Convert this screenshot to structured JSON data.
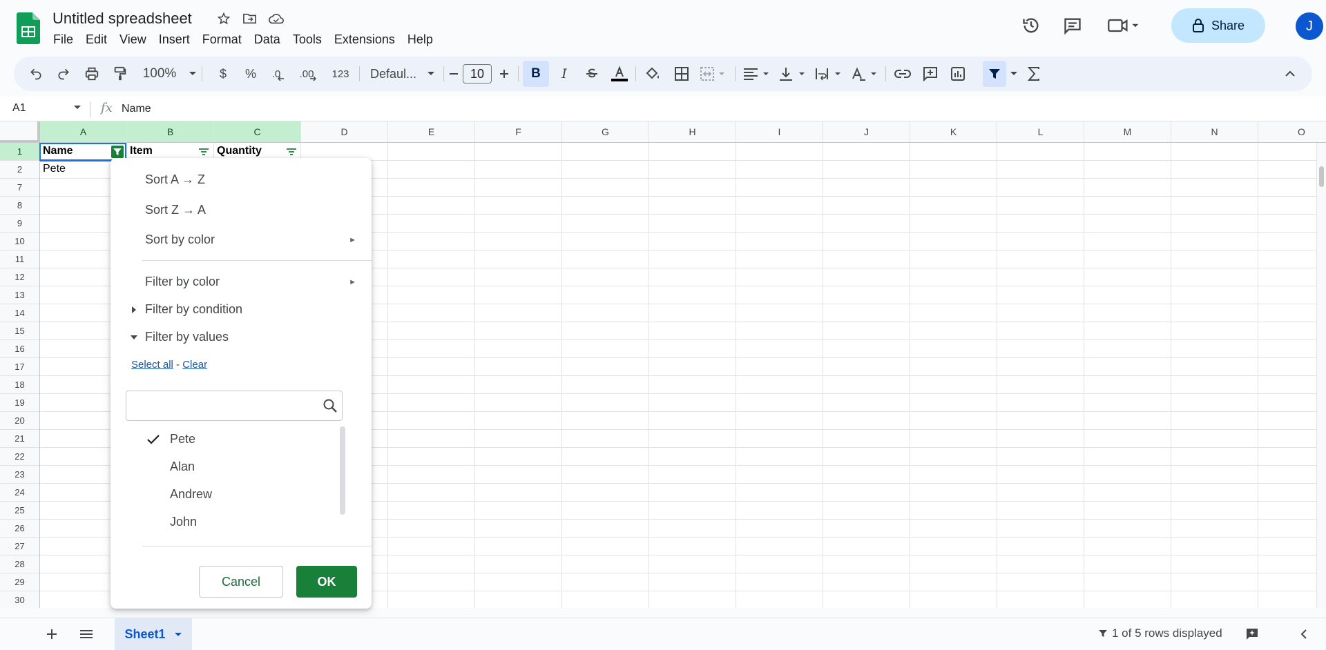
{
  "app": {
    "doc_title": "Untitled spreadsheet",
    "menu": [
      "File",
      "Edit",
      "View",
      "Insert",
      "Format",
      "Data",
      "Tools",
      "Extensions",
      "Help"
    ],
    "share_label": "Share",
    "avatar_initial": "J"
  },
  "toolbar": {
    "zoom": "100%",
    "currency": "$",
    "percent": "%",
    "dec_decrease": ".0",
    "dec_increase": ".00",
    "number_format": "123",
    "font_name": "Defaul...",
    "font_size": "10"
  },
  "formula_bar": {
    "cell_ref": "A1",
    "fx": "fx",
    "value": "Name"
  },
  "grid": {
    "columns": [
      "A",
      "B",
      "C",
      "D",
      "E",
      "F",
      "G",
      "H",
      "I",
      "J",
      "K",
      "L",
      "M",
      "N",
      "O"
    ],
    "rows": [
      "1",
      "2",
      "7",
      "8",
      "9",
      "10",
      "11",
      "12",
      "13",
      "14",
      "15",
      "16",
      "17",
      "18",
      "19",
      "20",
      "21",
      "22",
      "23",
      "24",
      "25",
      "26",
      "27",
      "28",
      "29",
      "30"
    ],
    "header_row": [
      "Name",
      "Item",
      "Quantity"
    ],
    "row2": [
      "Pete"
    ]
  },
  "filter_menu": {
    "sort_az": "Sort A → Z",
    "sort_za": "Sort Z → A",
    "sort_by_color": "Sort by color",
    "filter_by_color": "Filter by color",
    "filter_by_condition": "Filter by condition",
    "filter_by_values": "Filter by values",
    "select_all": "Select all",
    "link_sep": " - ",
    "clear": "Clear",
    "search_placeholder": "",
    "values": [
      {
        "label": "Pete",
        "checked": true
      },
      {
        "label": "Alan",
        "checked": false
      },
      {
        "label": "Andrew",
        "checked": false
      },
      {
        "label": "John",
        "checked": false
      }
    ],
    "cancel": "Cancel",
    "ok": "OK"
  },
  "bottom": {
    "sheet_name": "Sheet1",
    "rows_displayed": "1 of 5 rows displayed"
  },
  "colors": {
    "accent_green": "#188038",
    "share_bg": "#c2e7ff",
    "active_blue": "#d3e3fd"
  }
}
